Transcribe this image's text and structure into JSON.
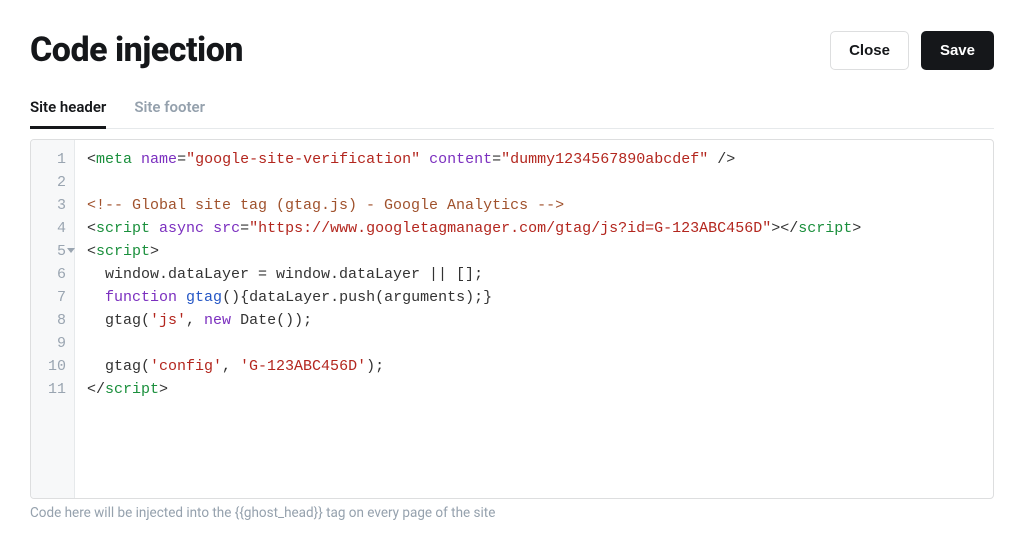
{
  "header": {
    "title": "Code injection",
    "close_label": "Close",
    "save_label": "Save"
  },
  "tabs": {
    "header_label": "Site header",
    "footer_label": "Site footer",
    "active": "header"
  },
  "editor": {
    "line_count": 11,
    "fold_line": 5,
    "lines": [
      {
        "n": 1,
        "segments": [
          {
            "t": "<",
            "c": "plain"
          },
          {
            "t": "meta",
            "c": "tag"
          },
          {
            "t": " ",
            "c": "plain"
          },
          {
            "t": "name",
            "c": "attr"
          },
          {
            "t": "=",
            "c": "plain"
          },
          {
            "t": "\"google-site-verification\"",
            "c": "str"
          },
          {
            "t": " ",
            "c": "plain"
          },
          {
            "t": "content",
            "c": "attr"
          },
          {
            "t": "=",
            "c": "plain"
          },
          {
            "t": "\"dummy1234567890abcdef\"",
            "c": "str"
          },
          {
            "t": " />",
            "c": "plain"
          }
        ]
      },
      {
        "n": 2,
        "segments": []
      },
      {
        "n": 3,
        "segments": [
          {
            "t": "<!-- Global site tag (gtag.js) - Google Analytics -->",
            "c": "comm"
          }
        ]
      },
      {
        "n": 4,
        "segments": [
          {
            "t": "<",
            "c": "plain"
          },
          {
            "t": "script",
            "c": "tag"
          },
          {
            "t": " ",
            "c": "plain"
          },
          {
            "t": "async",
            "c": "attr"
          },
          {
            "t": " ",
            "c": "plain"
          },
          {
            "t": "src",
            "c": "attr"
          },
          {
            "t": "=",
            "c": "plain"
          },
          {
            "t": "\"https://www.googletagmanager.com/gtag/js?id=G-123ABC456D\"",
            "c": "str"
          },
          {
            "t": "></",
            "c": "plain"
          },
          {
            "t": "script",
            "c": "tag"
          },
          {
            "t": ">",
            "c": "plain"
          }
        ]
      },
      {
        "n": 5,
        "segments": [
          {
            "t": "<",
            "c": "plain"
          },
          {
            "t": "script",
            "c": "tag"
          },
          {
            "t": ">",
            "c": "plain"
          }
        ]
      },
      {
        "n": 6,
        "segments": [
          {
            "t": "  window.dataLayer = window.dataLayer || [];",
            "c": "plain"
          }
        ]
      },
      {
        "n": 7,
        "segments": [
          {
            "t": "  ",
            "c": "plain"
          },
          {
            "t": "function",
            "c": "kw"
          },
          {
            "t": " ",
            "c": "plain"
          },
          {
            "t": "gtag",
            "c": "fn"
          },
          {
            "t": "(){dataLayer.push(arguments);}",
            "c": "plain"
          }
        ]
      },
      {
        "n": 8,
        "segments": [
          {
            "t": "  gtag(",
            "c": "plain"
          },
          {
            "t": "'js'",
            "c": "str"
          },
          {
            "t": ", ",
            "c": "plain"
          },
          {
            "t": "new",
            "c": "kw"
          },
          {
            "t": " Date());",
            "c": "plain"
          }
        ]
      },
      {
        "n": 9,
        "segments": []
      },
      {
        "n": 10,
        "segments": [
          {
            "t": "  gtag(",
            "c": "plain"
          },
          {
            "t": "'config'",
            "c": "str"
          },
          {
            "t": ", ",
            "c": "plain"
          },
          {
            "t": "'G-123ABC456D'",
            "c": "str"
          },
          {
            "t": ");",
            "c": "plain"
          }
        ]
      },
      {
        "n": 11,
        "segments": [
          {
            "t": "</",
            "c": "plain"
          },
          {
            "t": "script",
            "c": "tag"
          },
          {
            "t": ">",
            "c": "plain"
          }
        ]
      }
    ]
  },
  "helper_text": "Code here will be injected into the {{ghost_head}} tag on every page of the site"
}
